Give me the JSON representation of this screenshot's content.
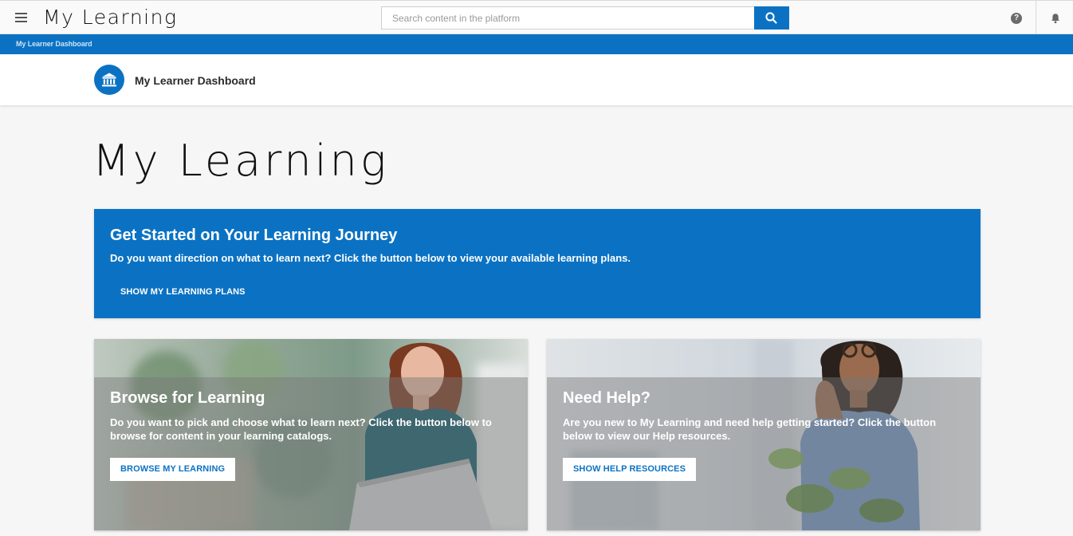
{
  "header": {
    "app_title": "My Learning",
    "search_placeholder": "Search content in the platform",
    "help_glyph": "?",
    "icons": {
      "menu": "hamburger-menu-icon",
      "search": "search-icon",
      "help": "help-circle-icon",
      "notifications": "bell-icon"
    }
  },
  "breadcrumb": {
    "current": "My Learner Dashboard"
  },
  "page_header": {
    "title": "My Learner Dashboard",
    "icon": "institution-building-icon"
  },
  "main": {
    "heading": "My Learning",
    "banner": {
      "title": "Get Started on Your Learning Journey",
      "text": "Do you want direction on what to learn next? Click the button below to view your available learning plans.",
      "button_label": "SHOW MY LEARNING PLANS"
    },
    "cards": [
      {
        "title": "Browse for Learning",
        "text": "Do you want to pick and choose what to learn next? Click the button below to browse for content in your learning catalogs.",
        "button_label": "BROWSE MY LEARNING"
      },
      {
        "title": "Need Help?",
        "text": "Are you new to My Learning and need help getting started? Click the button below to view our Help resources.",
        "button_label": "SHOW HELP RESOURCES"
      }
    ]
  },
  "colors": {
    "accent": "#0b72c3",
    "background": "#f6f6f6",
    "text_dark": "#111111"
  }
}
